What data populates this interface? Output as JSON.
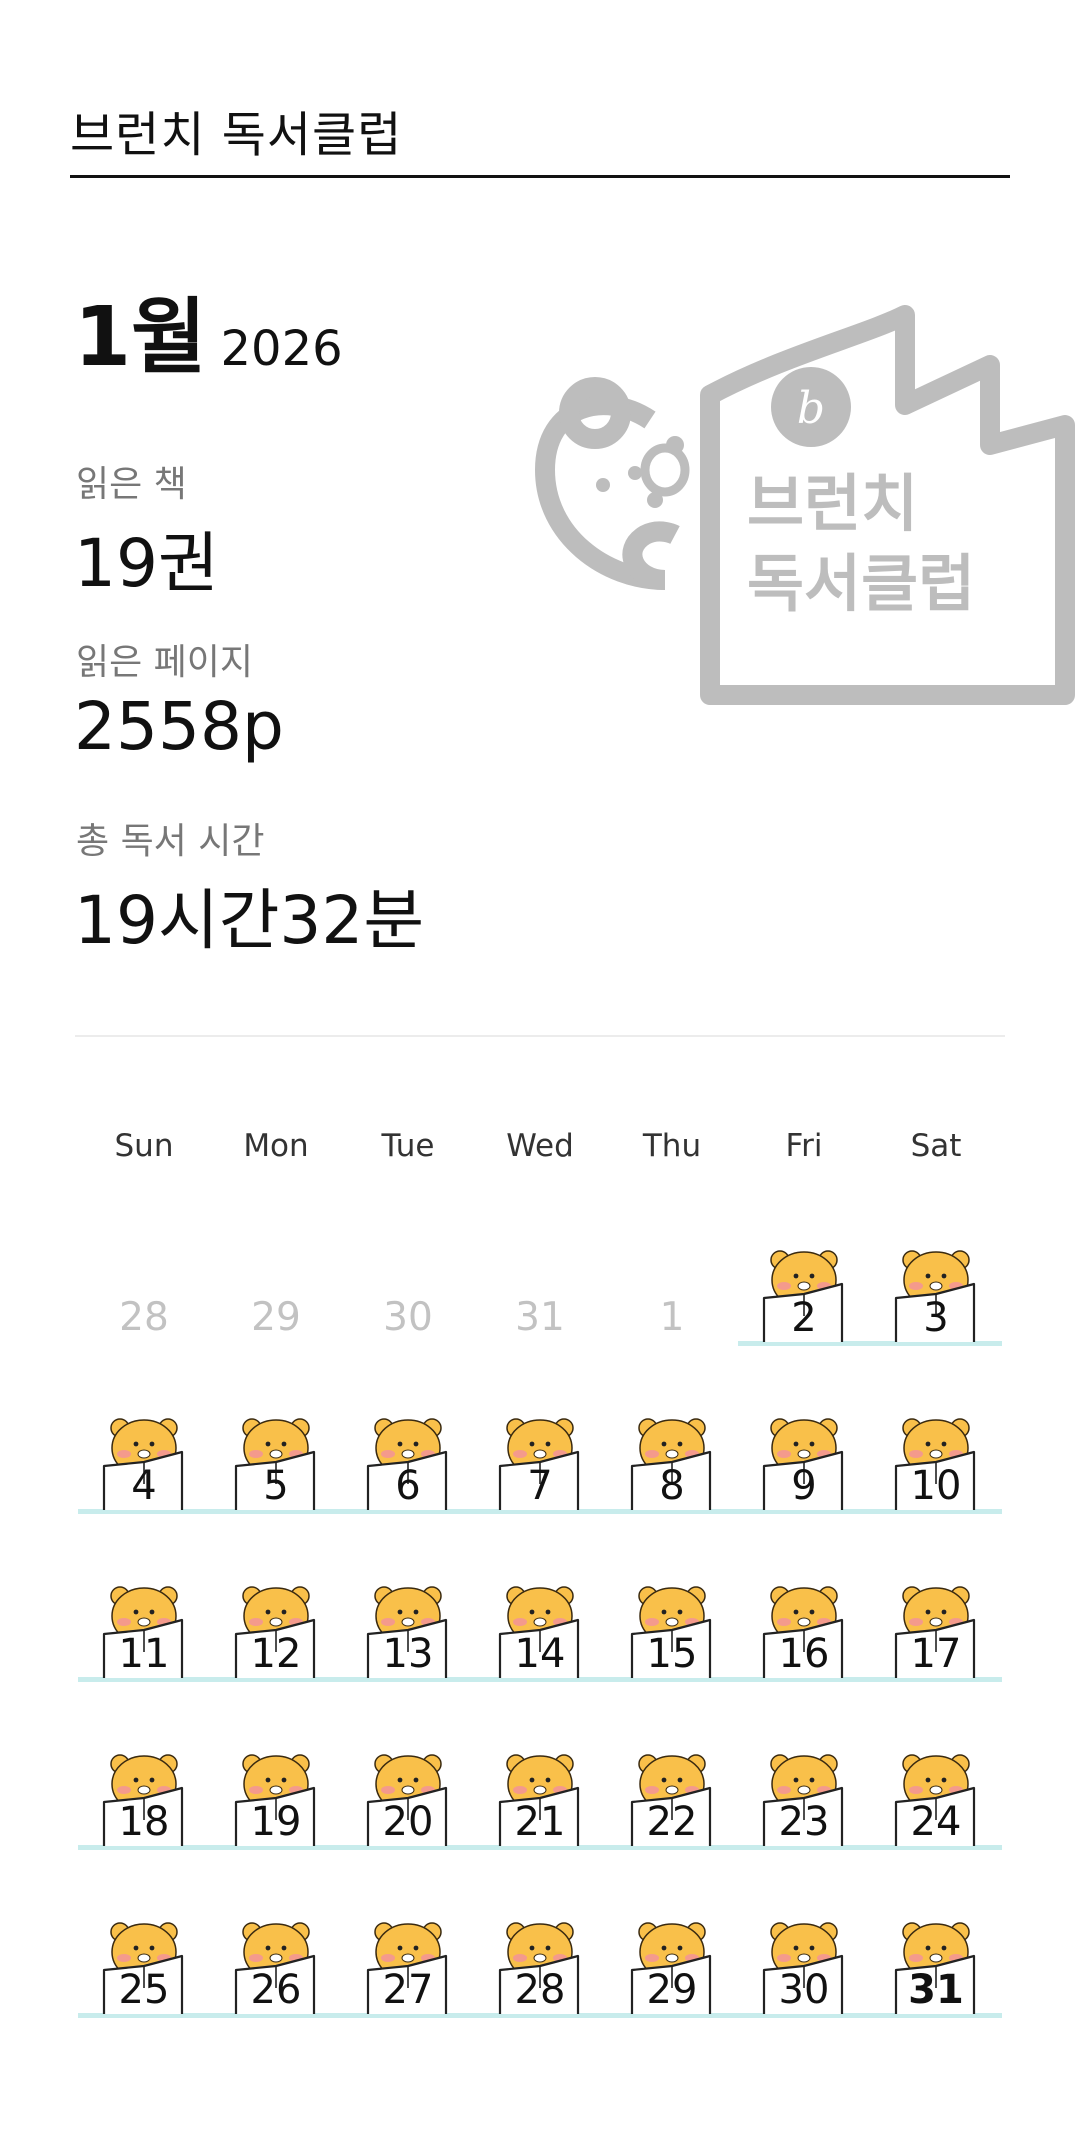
{
  "app": {
    "title": "브런치 독서클럽"
  },
  "period": {
    "month": "1월",
    "year": "2026"
  },
  "stats": [
    {
      "label": "읽은 책",
      "value": "19권"
    },
    {
      "label": "읽은 페이지",
      "value": "2558p"
    },
    {
      "label": "총 독서 시간",
      "value": "19시간32분"
    }
  ],
  "logo": {
    "line1": "브런치",
    "line2": "독서클럽",
    "mark": "b"
  },
  "weekdays": [
    "Sun",
    "Mon",
    "Tue",
    "Wed",
    "Thu",
    "Fri",
    "Sat"
  ],
  "calendar": [
    [
      {
        "day": "28",
        "in_month": false,
        "read": false
      },
      {
        "day": "29",
        "in_month": false,
        "read": false
      },
      {
        "day": "30",
        "in_month": false,
        "read": false
      },
      {
        "day": "31",
        "in_month": false,
        "read": false
      },
      {
        "day": "1",
        "in_month": false,
        "read": false
      },
      {
        "day": "2",
        "in_month": true,
        "read": true
      },
      {
        "day": "3",
        "in_month": true,
        "read": true
      }
    ],
    [
      {
        "day": "4",
        "in_month": true,
        "read": true
      },
      {
        "day": "5",
        "in_month": true,
        "read": true
      },
      {
        "day": "6",
        "in_month": true,
        "read": true
      },
      {
        "day": "7",
        "in_month": true,
        "read": true
      },
      {
        "day": "8",
        "in_month": true,
        "read": true
      },
      {
        "day": "9",
        "in_month": true,
        "read": true
      },
      {
        "day": "10",
        "in_month": true,
        "read": true
      }
    ],
    [
      {
        "day": "11",
        "in_month": true,
        "read": true
      },
      {
        "day": "12",
        "in_month": true,
        "read": true
      },
      {
        "day": "13",
        "in_month": true,
        "read": true
      },
      {
        "day": "14",
        "in_month": true,
        "read": true
      },
      {
        "day": "15",
        "in_month": true,
        "read": true
      },
      {
        "day": "16",
        "in_month": true,
        "read": true
      },
      {
        "day": "17",
        "in_month": true,
        "read": true
      }
    ],
    [
      {
        "day": "18",
        "in_month": true,
        "read": true
      },
      {
        "day": "19",
        "in_month": true,
        "read": true
      },
      {
        "day": "20",
        "in_month": true,
        "read": true
      },
      {
        "day": "21",
        "in_month": true,
        "read": true
      },
      {
        "day": "22",
        "in_month": true,
        "read": true
      },
      {
        "day": "23",
        "in_month": true,
        "read": true
      },
      {
        "day": "24",
        "in_month": true,
        "read": true
      }
    ],
    [
      {
        "day": "25",
        "in_month": true,
        "read": true
      },
      {
        "day": "26",
        "in_month": true,
        "read": true
      },
      {
        "day": "27",
        "in_month": true,
        "read": true
      },
      {
        "day": "28",
        "in_month": true,
        "read": true
      },
      {
        "day": "29",
        "in_month": true,
        "read": true
      },
      {
        "day": "30",
        "in_month": true,
        "read": true
      },
      {
        "day": "31",
        "in_month": true,
        "read": true,
        "today": true
      }
    ]
  ],
  "colors": {
    "underline": "#c8ecec",
    "sticker_face": "#f9c04a",
    "sticker_cheek": "#f49a8c",
    "logo_gray": "#b8b8b8"
  },
  "icons": {
    "read_sticker": "ryan-reading-book-icon",
    "logo": "brunch-book-club-logo"
  }
}
